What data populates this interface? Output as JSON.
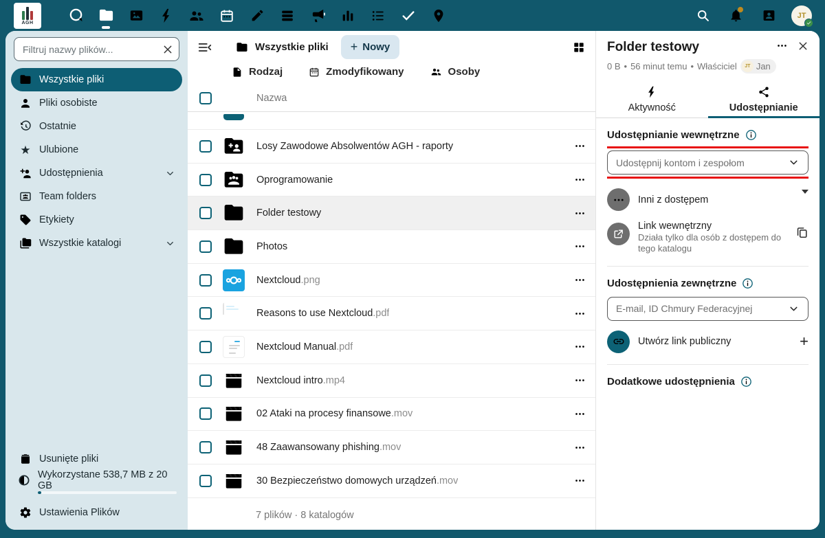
{
  "topbar": {
    "logo_text": "AGH",
    "apps": [
      {
        "icon": "talk-icon"
      },
      {
        "icon": "files-icon",
        "active": true
      },
      {
        "icon": "photos-icon"
      },
      {
        "icon": "activity-icon"
      },
      {
        "icon": "contacts-icon"
      },
      {
        "icon": "calendar-icon"
      },
      {
        "icon": "notes-icon"
      },
      {
        "icon": "deck-icon"
      },
      {
        "icon": "announcements-icon"
      },
      {
        "icon": "analytics-icon"
      },
      {
        "icon": "tasks-icon"
      },
      {
        "icon": "checks-icon"
      },
      {
        "icon": "maps-icon"
      }
    ],
    "right_icons": [
      "search-icon",
      "bell-icon",
      "contacts-menu-icon"
    ],
    "user_initials": "JT"
  },
  "sidebar": {
    "filter_placeholder": "Filtruj nazwy plików...",
    "items": [
      {
        "label": "Wszystkie pliki",
        "icon": "folder-icon",
        "active": true
      },
      {
        "label": "Pliki osobiste",
        "icon": "user-icon"
      },
      {
        "label": "Ostatnie",
        "icon": "history-icon"
      },
      {
        "label": "Ulubione",
        "icon": "star-icon"
      },
      {
        "label": "Udostępnienia",
        "icon": "share-user-icon",
        "chevron": true
      },
      {
        "label": "Team folders",
        "icon": "team-folder-icon"
      },
      {
        "label": "Etykiety",
        "icon": "tag-icon"
      },
      {
        "label": "Wszystkie katalogi",
        "icon": "folders-icon",
        "chevron": true
      }
    ],
    "bottom": {
      "trash_label": "Usunięte pliki",
      "quota_label": "Wykorzystane 538,7 MB z 20 GB",
      "quota_percent": 2.7,
      "settings_label": "Ustawienia Plików"
    }
  },
  "main": {
    "breadcrumb": "Wszystkie pliki",
    "new_button": "Nowy",
    "filters": [
      {
        "label": "Rodzaj",
        "icon": "file-icon"
      },
      {
        "label": "Zmodyfikowany",
        "icon": "calendar-icon"
      },
      {
        "label": "Osoby",
        "icon": "people-icon"
      }
    ],
    "columns": {
      "name": "Nazwa"
    },
    "rows": [
      {
        "name": "Losy Zawodowe Absolwentów AGH - raporty",
        "ext": "",
        "icon": "shared-folder-icon"
      },
      {
        "name": "Oprogramowanie",
        "ext": "",
        "icon": "group-folder-icon"
      },
      {
        "name": "Folder testowy",
        "ext": "",
        "icon": "folder-icon",
        "selected": true
      },
      {
        "name": "Photos",
        "ext": "",
        "icon": "folder-icon"
      },
      {
        "name": "Nextcloud",
        "ext": ".png",
        "icon": "image-thumbnail"
      },
      {
        "name": "Reasons to use Nextcloud",
        "ext": ".pdf",
        "icon": "pdf-thumbnail"
      },
      {
        "name": "Nextcloud Manual",
        "ext": ".pdf",
        "icon": "pdf-page-thumbnail"
      },
      {
        "name": "Nextcloud intro",
        "ext": ".mp4",
        "icon": "video-icon"
      },
      {
        "name": "02 Ataki na procesy finansowe",
        "ext": ".mov",
        "icon": "video-icon"
      },
      {
        "name": "48 Zaawansowany phishing",
        "ext": ".mov",
        "icon": "video-icon"
      },
      {
        "name": "30 Bezpieczeństwo domowych urządzeń",
        "ext": ".mov",
        "icon": "video-icon"
      }
    ],
    "summary": "7 plików · 8 katalogów"
  },
  "panel": {
    "title": "Folder testowy",
    "meta": {
      "size": "0 B",
      "sep1": "•",
      "time": "56 minut temu",
      "sep2": "•",
      "owner_label": "Właściciel",
      "owner_initials": "JT",
      "owner_name": "Jan"
    },
    "tabs": [
      {
        "label": "Aktywność",
        "icon": "activity-icon"
      },
      {
        "label": "Udostępnianie",
        "icon": "share-icon",
        "active": true
      }
    ],
    "internal": {
      "heading": "Udostępnianie wewnętrzne",
      "select_placeholder": "Udostępnij kontom i zespołom",
      "others_label": "Inni z dostępem",
      "internal_link_title": "Link wewnętrzny",
      "internal_link_desc": "Działa tylko dla osób z dostępem do tego katalogu"
    },
    "external": {
      "heading": "Udostępnienia zewnętrzne",
      "select_placeholder": "E-mail, ID Chmury Federacyjnej",
      "public_link_label": "Utwórz link publiczny"
    },
    "additional_heading": "Dodatkowe udostępnienia",
    "accent_color": "#0d5e74",
    "annotation_color": "#e81313"
  }
}
